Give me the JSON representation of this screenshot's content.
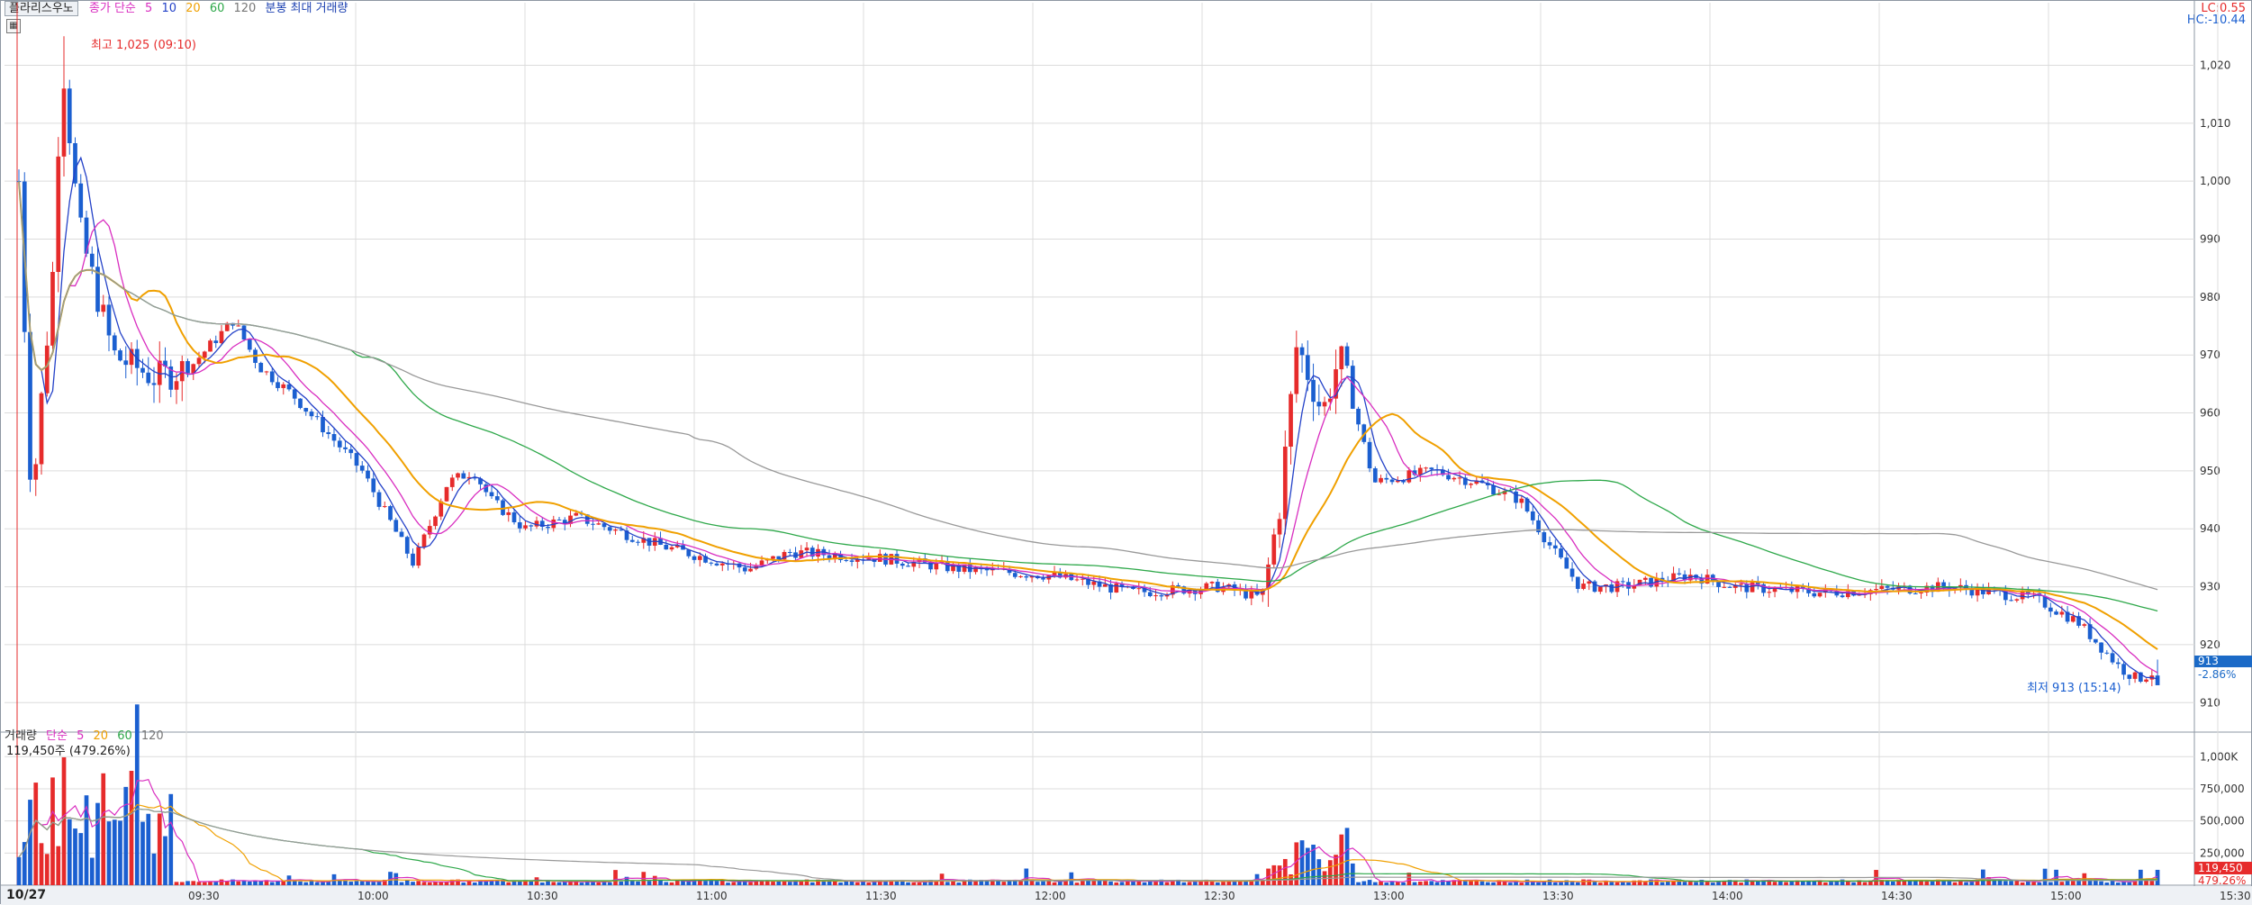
{
  "header": {
    "stock_name": "플라리스우노",
    "price_ma_label": "종가 단순",
    "price_ma_periods": [
      "5",
      "10",
      "20",
      "60",
      "120"
    ],
    "extra_label": "분봉 최대 거래량"
  },
  "volume_header": {
    "label": "거래량",
    "ma_label": "단순",
    "ma_periods": [
      "5",
      "20",
      "60",
      "120"
    ],
    "current_value": "119,450주 (479.26%)"
  },
  "right_labels": {
    "lc": "LC:0.55",
    "hc": "HC:-10.44"
  },
  "current": {
    "price": "913",
    "price_change": "-2.86%",
    "volume": "119,450",
    "volume_change": "479.26%"
  },
  "annotations": {
    "high": "최고 1,025 (09:10)",
    "low": "최저 913 (15:14)"
  },
  "date_label": "10/27",
  "colors": {
    "up": "#e62b2b",
    "down": "#1b5fd0",
    "ma5": "#2442c8",
    "ma10": "#d92ec0",
    "ma20": "#f0a000",
    "ma60": "#2ea84a",
    "ma120": "#999999",
    "grid": "#dcdcdc",
    "axis_text": "#333333"
  },
  "chart_data": {
    "type": "candlestick",
    "price_ticks": [
      "910",
      "920",
      "930",
      "940",
      "950",
      "960",
      "970",
      "980",
      "990",
      "1,000",
      "1,010",
      "1,020"
    ],
    "volume_ticks": [
      "250,000",
      "500,000",
      "750,000",
      "1,000K"
    ],
    "x_ticks": [
      "09:30",
      "10:00",
      "10:30",
      "11:00",
      "11:30",
      "12:00",
      "12:30",
      "13:00",
      "13:30",
      "14:00",
      "14:30",
      "15:00",
      "15:30:00"
    ],
    "price_range": [
      906,
      1028
    ],
    "volume_max": 1100000,
    "open_price": 1000,
    "high": 1025,
    "low": 913,
    "close": 913
  }
}
